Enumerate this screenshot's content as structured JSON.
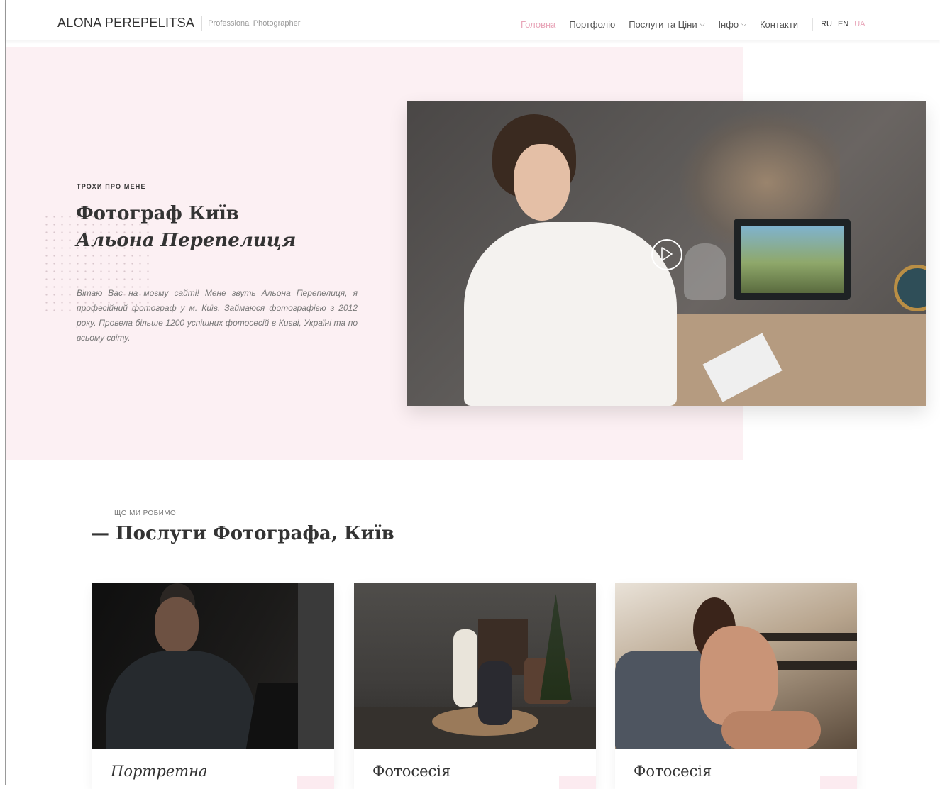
{
  "header": {
    "brand_name": "ALONA PEREPELITSA",
    "brand_tagline": "Professional Photographer",
    "nav": [
      {
        "label": "Головна",
        "active": true,
        "dropdown": false
      },
      {
        "label": "Портфоліо",
        "active": false,
        "dropdown": false
      },
      {
        "label": "Послуги та Ціни",
        "active": false,
        "dropdown": true
      },
      {
        "label": "Інфо",
        "active": false,
        "dropdown": true
      },
      {
        "label": "Контакти",
        "active": false,
        "dropdown": false
      }
    ],
    "languages": [
      {
        "code": "RU",
        "active": false
      },
      {
        "code": "EN",
        "active": false
      },
      {
        "code": "UA",
        "active": true
      }
    ]
  },
  "hero": {
    "eyebrow": "ТРОХИ ПРО МЕНЕ",
    "title_line1": "Фотограф Київ",
    "title_line2": "Альона Перепелиця",
    "intro": "Вітаю Вас на моєму сайті! Мене звуть Альона Перепелиця, я професійний фотограф у м. Київ. Займаюся фотографією з 2012 року. Провела більше 1200 успішних фотосесій в Києві, Україні та по всьому світу.",
    "video_icon": "play-icon"
  },
  "services": {
    "eyebrow": "ЩО МИ РОБИМО",
    "title": "— Послуги Фотографа, Київ",
    "cards": [
      {
        "title": "Портретна",
        "italic": true
      },
      {
        "title": "Фотосесія",
        "italic": false
      },
      {
        "title": "Фотосесія",
        "italic": false
      }
    ]
  },
  "colors": {
    "accent": "#e8a5b8",
    "hero_background": "#fcf0f3",
    "text": "#333333"
  }
}
